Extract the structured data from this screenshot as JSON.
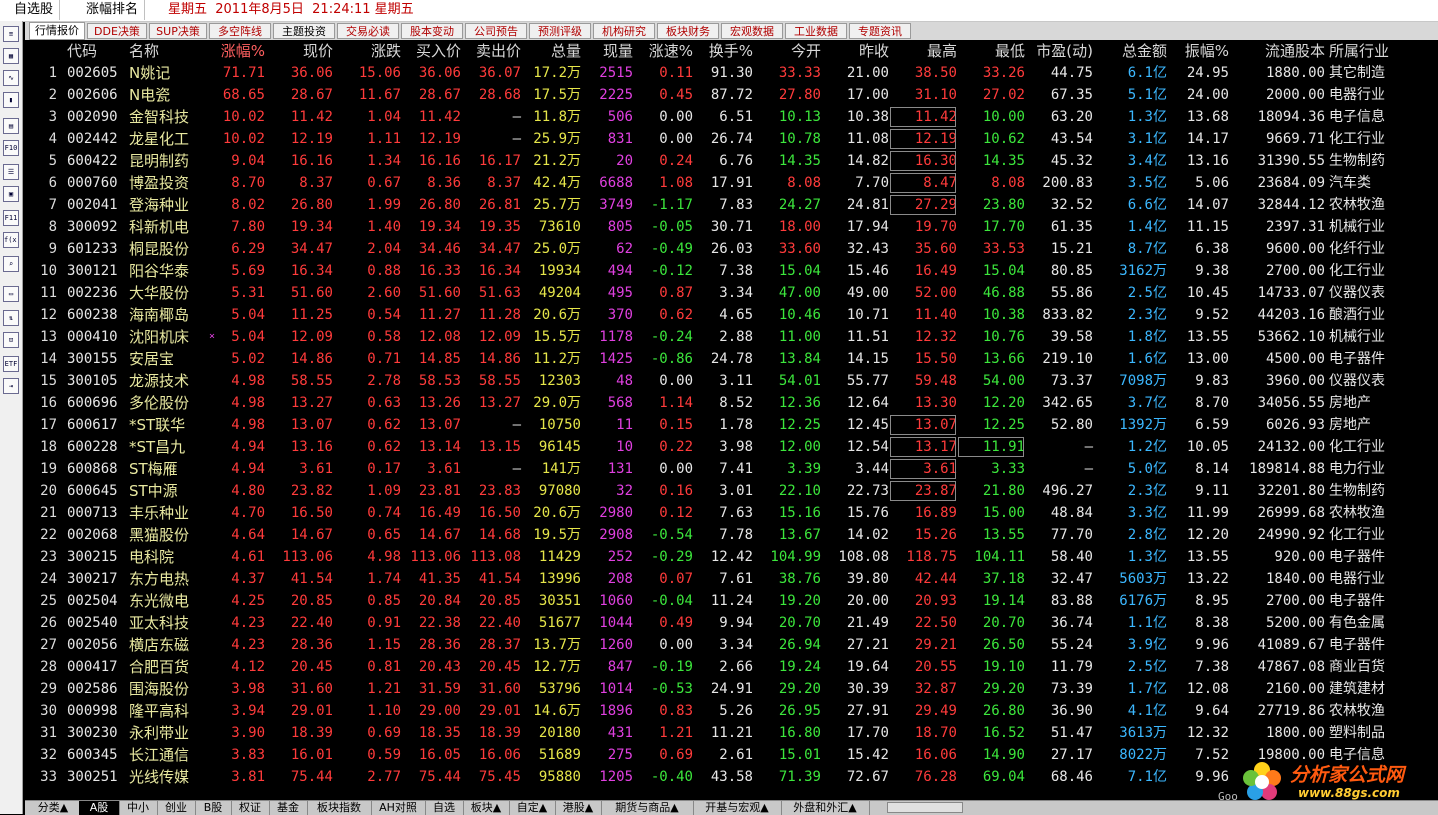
{
  "titlebar": {
    "btn1": "自选股",
    "btn2": "涨幅排名",
    "datetime": "星期五  2011年8月5日  21:24:11 星期五"
  },
  "tabs": [
    "行情报价",
    "DDE决策",
    "SUP决策",
    "多空阵线",
    "主题投资",
    "交易必读",
    "股本变动",
    "公司预告",
    "预测评级",
    "机构研究",
    "板块财务",
    "宏观数据",
    "工业数据",
    "专题资讯"
  ],
  "headers": [
    "代码",
    "名称",
    "涨幅%",
    "现价",
    "涨跌",
    "买入价",
    "卖出价",
    "总量",
    "现量",
    "涨速%",
    "换手%",
    "今开",
    "昨收",
    "最高",
    "最低",
    "市盈(动)",
    "总金额",
    "振幅%",
    "流通股本",
    "所属行业"
  ],
  "rows": [
    [
      "1",
      "002605",
      "N姚记",
      "71.71",
      "36.06",
      "15.06",
      "36.06",
      "36.07",
      "17.2万",
      "2515",
      "0.11",
      "91.30",
      "33.33",
      "21.00",
      "38.50",
      "33.26",
      "44.75",
      "6.1亿",
      "24.95",
      "1880.00",
      "其它制造"
    ],
    [
      "2",
      "002606",
      "N电瓷",
      "68.65",
      "28.67",
      "11.67",
      "28.67",
      "28.68",
      "17.5万",
      "2225",
      "0.45",
      "87.72",
      "27.80",
      "17.00",
      "31.10",
      "27.02",
      "67.35",
      "5.1亿",
      "24.00",
      "2000.00",
      "电器行业"
    ],
    [
      "3",
      "002090",
      "金智科技",
      "10.02",
      "11.42",
      "1.04",
      "11.42",
      "—",
      "11.8万",
      "506",
      "0.00",
      "6.51",
      "10.13",
      "10.38",
      "11.42",
      "10.00",
      "63.20",
      "1.3亿",
      "13.68",
      "18094.36",
      "电子信息"
    ],
    [
      "4",
      "002442",
      "龙星化工",
      "10.02",
      "12.19",
      "1.11",
      "12.19",
      "—",
      "25.9万",
      "831",
      "0.00",
      "26.74",
      "10.78",
      "11.08",
      "12.19",
      "10.62",
      "43.54",
      "3.1亿",
      "14.17",
      "9669.71",
      "化工行业"
    ],
    [
      "5",
      "600422",
      "昆明制药",
      "9.04",
      "16.16",
      "1.34",
      "16.16",
      "16.17",
      "21.2万",
      "20",
      "0.24",
      "6.76",
      "14.35",
      "14.82",
      "16.30",
      "14.35",
      "45.32",
      "3.4亿",
      "13.16",
      "31390.55",
      "生物制药"
    ],
    [
      "6",
      "000760",
      "博盈投资",
      "8.70",
      "8.37",
      "0.67",
      "8.36",
      "8.37",
      "42.4万",
      "6688",
      "1.08",
      "17.91",
      "8.08",
      "7.70",
      "8.47",
      "8.08",
      "200.83",
      "3.5亿",
      "5.06",
      "23684.09",
      "汽车类"
    ],
    [
      "7",
      "002041",
      "登海种业",
      "8.02",
      "26.80",
      "1.99",
      "26.80",
      "26.81",
      "25.7万",
      "3749",
      "-1.17",
      "7.83",
      "24.27",
      "24.81",
      "27.29",
      "23.80",
      "32.52",
      "6.6亿",
      "14.07",
      "32844.12",
      "农林牧渔"
    ],
    [
      "8",
      "300092",
      "科新机电",
      "7.80",
      "19.34",
      "1.40",
      "19.34",
      "19.35",
      "73610",
      "805",
      "-0.05",
      "30.71",
      "18.00",
      "17.94",
      "19.70",
      "17.70",
      "61.35",
      "1.4亿",
      "11.15",
      "2397.31",
      "机械行业"
    ],
    [
      "9",
      "601233",
      "桐昆股份",
      "6.29",
      "34.47",
      "2.04",
      "34.46",
      "34.47",
      "25.0万",
      "62",
      "-0.49",
      "26.03",
      "33.60",
      "32.43",
      "35.60",
      "33.53",
      "15.21",
      "8.7亿",
      "6.38",
      "9600.00",
      "化纤行业"
    ],
    [
      "10",
      "300121",
      "阳谷华泰",
      "5.69",
      "16.34",
      "0.88",
      "16.33",
      "16.34",
      "19934",
      "494",
      "-0.12",
      "7.38",
      "15.04",
      "15.46",
      "16.49",
      "15.04",
      "80.85",
      "3162万",
      "9.38",
      "2700.00",
      "化工行业"
    ],
    [
      "11",
      "002236",
      "大华股份",
      "5.31",
      "51.60",
      "2.60",
      "51.60",
      "51.63",
      "49204",
      "495",
      "0.87",
      "3.34",
      "47.00",
      "49.00",
      "52.00",
      "46.88",
      "55.86",
      "2.5亿",
      "10.45",
      "14733.07",
      "仪器仪表"
    ],
    [
      "12",
      "600238",
      "海南椰岛",
      "5.04",
      "11.25",
      "0.54",
      "11.27",
      "11.28",
      "20.6万",
      "370",
      "0.62",
      "4.65",
      "10.46",
      "10.71",
      "11.40",
      "10.38",
      "833.82",
      "2.3亿",
      "9.52",
      "44203.16",
      "酿酒行业"
    ],
    [
      "13",
      "000410",
      "沈阳机床",
      "5.04",
      "12.09",
      "0.58",
      "12.08",
      "12.09",
      "15.5万",
      "1178",
      "-0.24",
      "2.88",
      "11.00",
      "11.51",
      "12.32",
      "10.76",
      "39.58",
      "1.8亿",
      "13.55",
      "53662.10",
      "机械行业"
    ],
    [
      "14",
      "300155",
      "安居宝",
      "5.02",
      "14.86",
      "0.71",
      "14.85",
      "14.86",
      "11.2万",
      "1425",
      "-0.86",
      "24.78",
      "13.84",
      "14.15",
      "15.50",
      "13.66",
      "219.10",
      "1.6亿",
      "13.00",
      "4500.00",
      "电子器件"
    ],
    [
      "15",
      "300105",
      "龙源技术",
      "4.98",
      "58.55",
      "2.78",
      "58.53",
      "58.55",
      "12303",
      "48",
      "0.00",
      "3.11",
      "54.01",
      "55.77",
      "59.48",
      "54.00",
      "73.37",
      "7098万",
      "9.83",
      "3960.00",
      "仪器仪表"
    ],
    [
      "16",
      "600696",
      "多伦股份",
      "4.98",
      "13.27",
      "0.63",
      "13.26",
      "13.27",
      "29.0万",
      "568",
      "1.14",
      "8.52",
      "12.36",
      "12.64",
      "13.30",
      "12.20",
      "342.65",
      "3.7亿",
      "8.70",
      "34056.55",
      "房地产"
    ],
    [
      "17",
      "600617",
      "*ST联华",
      "4.98",
      "13.07",
      "0.62",
      "13.07",
      "—",
      "10750",
      "11",
      "0.15",
      "1.78",
      "12.25",
      "12.45",
      "13.07",
      "12.25",
      "52.80",
      "1392万",
      "6.59",
      "6026.93",
      "房地产"
    ],
    [
      "18",
      "600228",
      "*ST昌九",
      "4.94",
      "13.16",
      "0.62",
      "13.14",
      "13.15",
      "96145",
      "10",
      "0.22",
      "3.98",
      "12.00",
      "12.54",
      "13.17",
      "11.91",
      "—",
      "1.2亿",
      "10.05",
      "24132.00",
      "化工行业"
    ],
    [
      "19",
      "600868",
      "ST梅雁",
      "4.94",
      "3.61",
      "0.17",
      "3.61",
      "—",
      "141万",
      "131",
      "0.00",
      "7.41",
      "3.39",
      "3.44",
      "3.61",
      "3.33",
      "—",
      "5.0亿",
      "8.14",
      "189814.88",
      "电力行业"
    ],
    [
      "20",
      "600645",
      "ST中源",
      "4.80",
      "23.82",
      "1.09",
      "23.81",
      "23.83",
      "97080",
      "32",
      "0.16",
      "3.01",
      "22.10",
      "22.73",
      "23.87",
      "21.80",
      "496.27",
      "2.3亿",
      "9.11",
      "32201.80",
      "生物制药"
    ],
    [
      "21",
      "000713",
      "丰乐种业",
      "4.70",
      "16.50",
      "0.74",
      "16.49",
      "16.50",
      "20.6万",
      "2980",
      "0.12",
      "7.63",
      "15.16",
      "15.76",
      "16.89",
      "15.00",
      "48.84",
      "3.3亿",
      "11.99",
      "26999.68",
      "农林牧渔"
    ],
    [
      "22",
      "002068",
      "黑猫股份",
      "4.64",
      "14.67",
      "0.65",
      "14.67",
      "14.68",
      "19.5万",
      "2908",
      "-0.54",
      "7.78",
      "13.67",
      "14.02",
      "15.26",
      "13.55",
      "77.70",
      "2.8亿",
      "12.20",
      "24990.92",
      "化工行业"
    ],
    [
      "23",
      "300215",
      "电科院",
      "4.61",
      "113.06",
      "4.98",
      "113.06",
      "113.08",
      "11429",
      "252",
      "-0.29",
      "12.42",
      "104.99",
      "108.08",
      "118.75",
      "104.11",
      "58.40",
      "1.3亿",
      "13.55",
      "920.00",
      "电子器件"
    ],
    [
      "24",
      "300217",
      "东方电热",
      "4.37",
      "41.54",
      "1.74",
      "41.35",
      "41.54",
      "13996",
      "208",
      "0.07",
      "7.61",
      "38.76",
      "39.80",
      "42.44",
      "37.18",
      "32.47",
      "5603万",
      "13.22",
      "1840.00",
      "电器行业"
    ],
    [
      "25",
      "002504",
      "东光微电",
      "4.25",
      "20.85",
      "0.85",
      "20.84",
      "20.85",
      "30351",
      "1060",
      "-0.04",
      "11.24",
      "19.20",
      "20.00",
      "20.93",
      "19.14",
      "83.88",
      "6176万",
      "8.95",
      "2700.00",
      "电子器件"
    ],
    [
      "26",
      "002540",
      "亚太科技",
      "4.23",
      "22.40",
      "0.91",
      "22.38",
      "22.40",
      "51677",
      "1044",
      "0.49",
      "9.94",
      "20.70",
      "21.49",
      "22.50",
      "20.70",
      "36.74",
      "1.1亿",
      "8.38",
      "5200.00",
      "有色金属"
    ],
    [
      "27",
      "002056",
      "横店东磁",
      "4.23",
      "28.36",
      "1.15",
      "28.36",
      "28.37",
      "13.7万",
      "1260",
      "0.00",
      "3.34",
      "26.94",
      "27.21",
      "29.21",
      "26.50",
      "55.24",
      "3.9亿",
      "9.96",
      "41089.67",
      "电子器件"
    ],
    [
      "28",
      "000417",
      "合肥百货",
      "4.12",
      "20.45",
      "0.81",
      "20.43",
      "20.45",
      "12.7万",
      "847",
      "-0.19",
      "2.66",
      "19.24",
      "19.64",
      "20.55",
      "19.10",
      "11.79",
      "2.5亿",
      "7.38",
      "47867.08",
      "商业百货"
    ],
    [
      "29",
      "002586",
      "围海股份",
      "3.98",
      "31.60",
      "1.21",
      "31.59",
      "31.60",
      "53796",
      "1014",
      "-0.53",
      "24.91",
      "29.20",
      "30.39",
      "32.87",
      "29.20",
      "73.39",
      "1.7亿",
      "12.08",
      "2160.00",
      "建筑建材"
    ],
    [
      "30",
      "000998",
      "隆平高科",
      "3.94",
      "29.01",
      "1.10",
      "29.00",
      "29.01",
      "14.6万",
      "1896",
      "0.83",
      "5.26",
      "26.95",
      "27.91",
      "29.49",
      "26.80",
      "36.90",
      "4.1亿",
      "9.64",
      "27719.86",
      "农林牧渔"
    ],
    [
      "31",
      "300230",
      "永利带业",
      "3.90",
      "18.39",
      "0.69",
      "18.35",
      "18.39",
      "20180",
      "431",
      "1.21",
      "11.21",
      "16.80",
      "17.70",
      "18.70",
      "16.52",
      "51.47",
      "3613万",
      "12.32",
      "1800.00",
      "塑料制品"
    ],
    [
      "32",
      "600345",
      "长江通信",
      "3.83",
      "16.01",
      "0.59",
      "16.05",
      "16.06",
      "51689",
      "275",
      "0.69",
      "2.61",
      "15.01",
      "15.42",
      "16.06",
      "14.90",
      "27.17",
      "8022万",
      "7.52",
      "19800.00",
      "电子信息"
    ],
    [
      "33",
      "300251",
      "光线传媒",
      "3.81",
      "75.44",
      "2.77",
      "75.44",
      "75.45",
      "95880",
      "1205",
      "-0.40",
      "43.58",
      "71.39",
      "72.67",
      "76.28",
      "69.04",
      "68.46",
      "7.1亿",
      "9.96",
      "",
      ""
    ]
  ],
  "boxed_high_rows": [
    3,
    4,
    5,
    6,
    7,
    17,
    18,
    19,
    20
  ],
  "boxed_low_rows": [
    18
  ],
  "row13_marker": "×",
  "bottom_tabs": [
    "分类▲",
    "A股",
    "中小",
    "创业",
    "B股",
    "权证",
    "基金",
    "板块指数",
    "AH对照",
    "自选",
    "板块▲",
    "自定▲",
    "港股▲",
    "期货与商品▲",
    "开基与宏观▲",
    "外盘和外汇▲"
  ],
  "watermark": {
    "title": "分析家公式网",
    "url": "www.88gs.com",
    "small": "Goo"
  },
  "colors": {
    "up": "#ff3b3b",
    "down": "#3ce63c",
    "volume": "#e6e64a",
    "current_vol": "#e040e0",
    "amount_unit": "#3cb8ff"
  }
}
